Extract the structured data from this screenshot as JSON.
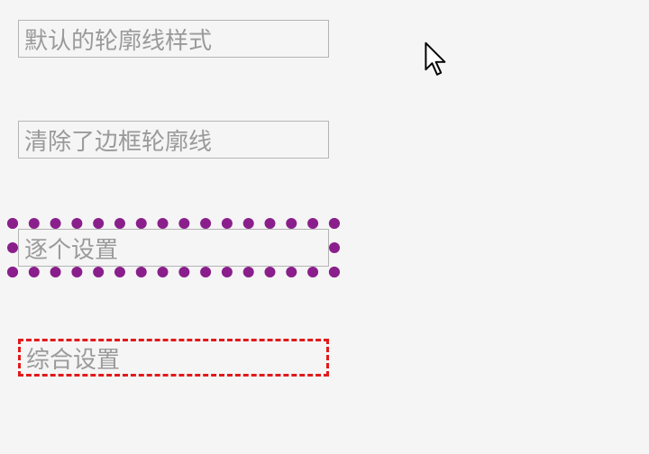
{
  "inputs": {
    "default_outline": "默认的轮廓线样式",
    "cleared_outline": "清除了边框轮廓线",
    "individual_set": "逐个设置",
    "combined_set": "综合设置"
  },
  "colors": {
    "dotted_outline": "#8a1f8c",
    "dashed_border": "#e11a1a"
  }
}
